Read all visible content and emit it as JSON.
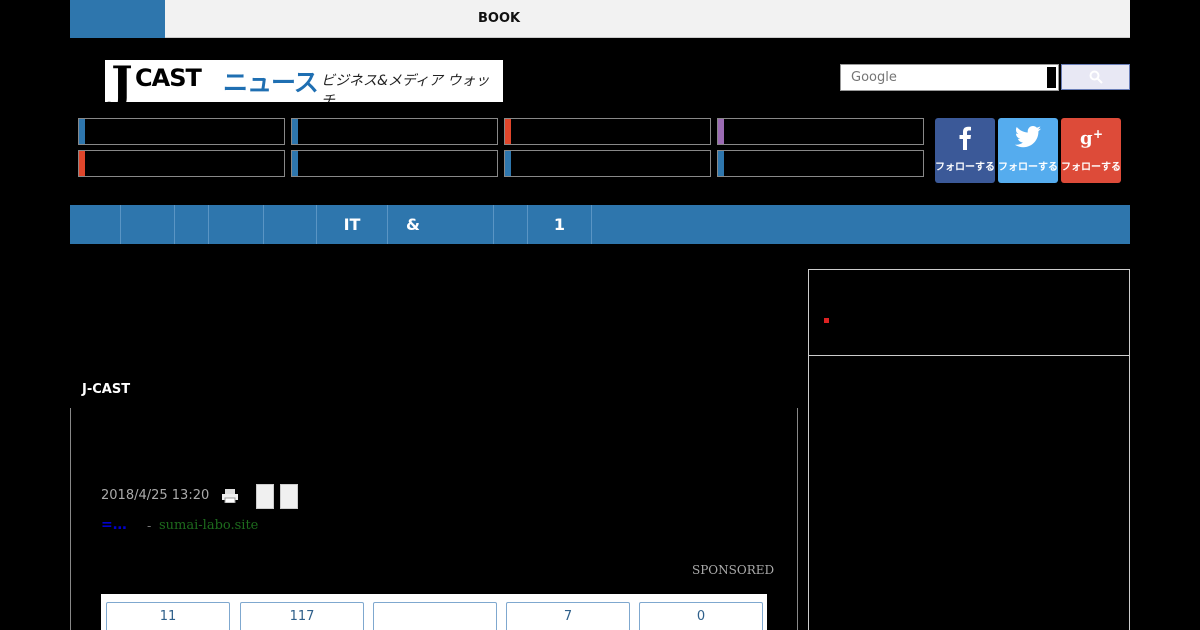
{
  "topbar": {
    "book_label": "BOOK"
  },
  "logo": {
    "j": "J",
    "cast": "CAST",
    "news": "ニュース",
    "tagline": "ビジネス&メディア ウォッチ"
  },
  "search": {
    "placeholder": "Google"
  },
  "categories": {
    "accents": [
      "#2e76ad",
      "#2e76ad",
      "#e0462b",
      "#9b6bb3",
      "#e0462b",
      "#2e76ad",
      "#2e76ad",
      "#2e76ad"
    ]
  },
  "social": [
    {
      "icon": "facebook-icon",
      "label": "フォローする",
      "color": "#3b5998"
    },
    {
      "icon": "twitter-icon",
      "label": "フォローする",
      "color": "#55acee"
    },
    {
      "icon": "google-plus-icon",
      "label": "フォローする",
      "color": "#dd4b39"
    }
  ],
  "nav": {
    "items": [
      "",
      "",
      "",
      "",
      "",
      "IT",
      "&",
      "",
      "1"
    ]
  },
  "section_label": "J-CAST",
  "article": {
    "date": "2018/4/25 13:20"
  },
  "ad": {
    "link_text": "=…",
    "separator": "-",
    "site": "sumai-labo.site",
    "sponsored": "SPONSORED"
  },
  "share_counts": [
    "11",
    "117",
    "",
    "7",
    "0"
  ],
  "colors": {
    "brand_blue": "#2e76ad",
    "accent_red": "#e0462b"
  }
}
